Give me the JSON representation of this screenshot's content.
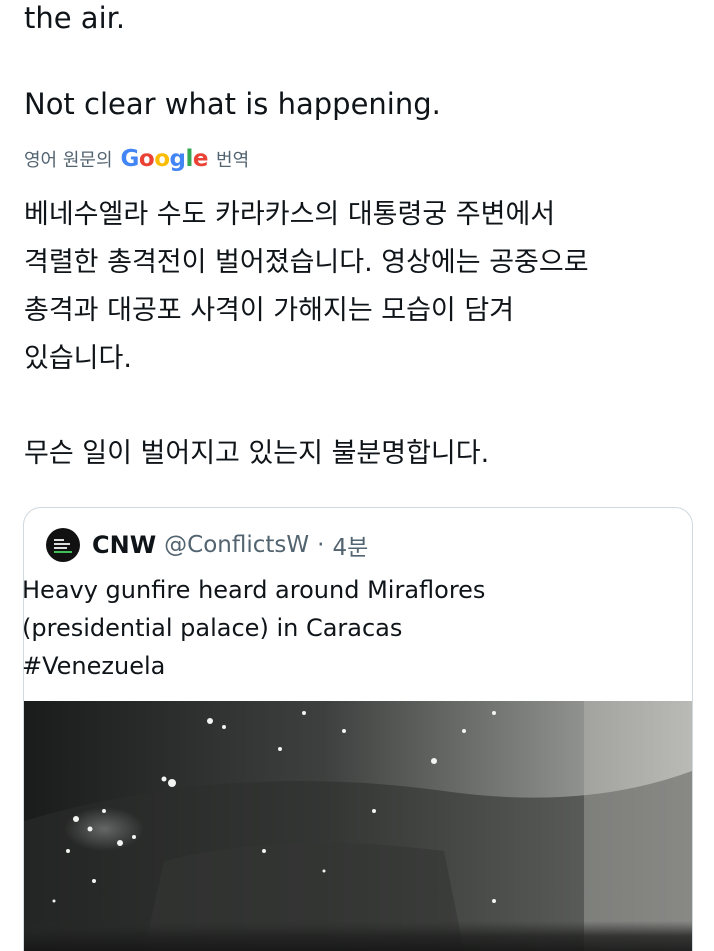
{
  "tweet": {
    "english_lines": [
      "the air.",
      "Not clear what is happening."
    ],
    "translate": {
      "prefix": "영어 원문의",
      "brand": "Google",
      "suffix": "번역",
      "brand_colors": [
        "#4285F4",
        "#EA4335",
        "#FBBC05",
        "#4285F4",
        "#34A853",
        "#EA4335"
      ]
    },
    "korean_lines": [
      "베네수엘라 수도 카라카스의 대통령궁 주변에서",
      "격렬한 총격전이 벌어졌습니다. 영상에는 공중으로",
      "총격과 대공포 사격이 가해지는 모습이 담겨",
      "있습니다.",
      "무슨 일이 벌어지고 있는지 불분명합니다."
    ]
  },
  "quoted": {
    "name": "CNW",
    "handle": "@ConflictsW",
    "separator": "·",
    "time": "4분",
    "text_lines": [
      "Heavy gunfire heard around Miraflores",
      "(presidential palace) in Caracas",
      "#Venezuela"
    ]
  }
}
